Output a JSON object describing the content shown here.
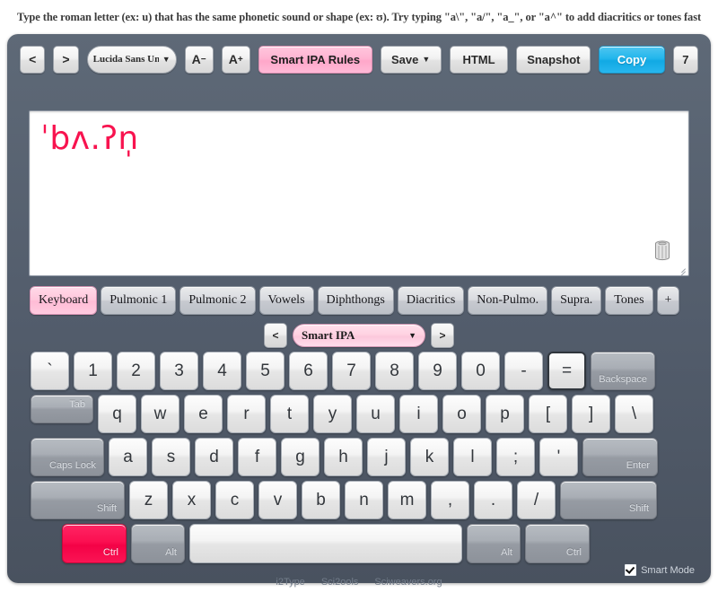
{
  "hint": "Type the roman letter (ex: u) that has the same phonetic sound or shape (ex: ʊ). Try typing \"a\\\", \"a/\", \"a_\", or \"a^\" to add diacritics or tones fast",
  "toolbar": {
    "prev_label": "<",
    "next_label": ">",
    "font_name": "Lucida Sans Unic",
    "font_caret": "▼",
    "font_decrease": "A",
    "font_decrease_sup": "−",
    "font_increase": "A",
    "font_increase_sup": "+",
    "rules_label": "Smart IPA Rules",
    "save_label": "Save",
    "save_caret": "▼",
    "html_label": "HTML",
    "snapshot_label": "Snapshot",
    "copy_label": "Copy",
    "char_count": "7",
    "accent_pink": "#ffb4d2",
    "accent_blue": "#11a9e4"
  },
  "editor": {
    "content": "ˈbʌ.ʔn̩",
    "text_color": "#f8134f"
  },
  "tabs": [
    {
      "label": "Keyboard",
      "active": true
    },
    {
      "label": "Pulmonic 1",
      "active": false
    },
    {
      "label": "Pulmonic 2",
      "active": false
    },
    {
      "label": "Vowels",
      "active": false
    },
    {
      "label": "Diphthongs",
      "active": false
    },
    {
      "label": "Diacritics",
      "active": false
    },
    {
      "label": "Non-Pulmo.",
      "active": false
    },
    {
      "label": "Supra.",
      "active": false
    },
    {
      "label": "Tones",
      "active": false
    },
    {
      "label": "+",
      "active": false
    }
  ],
  "layout_selector": {
    "prev_label": "<",
    "next_label": ">",
    "selected": "Smart IPA",
    "caret": "▼"
  },
  "keyboard": {
    "rows": [
      [
        {
          "label": "`",
          "type": "key"
        },
        {
          "label": "1",
          "type": "key"
        },
        {
          "label": "2",
          "type": "key"
        },
        {
          "label": "3",
          "type": "key"
        },
        {
          "label": "4",
          "type": "key"
        },
        {
          "label": "5",
          "type": "key"
        },
        {
          "label": "6",
          "type": "key"
        },
        {
          "label": "7",
          "type": "key"
        },
        {
          "label": "8",
          "type": "key"
        },
        {
          "label": "9",
          "type": "key"
        },
        {
          "label": "0",
          "type": "key"
        },
        {
          "label": "-",
          "type": "key"
        },
        {
          "label": "=",
          "type": "key",
          "state": "focused"
        },
        {
          "label": "Backspace",
          "type": "mod",
          "width": "backspace"
        }
      ],
      [
        {
          "label": "Tab",
          "type": "mod",
          "width": "tab"
        },
        {
          "label": "q",
          "type": "key"
        },
        {
          "label": "w",
          "type": "key"
        },
        {
          "label": "e",
          "type": "key"
        },
        {
          "label": "r",
          "type": "key"
        },
        {
          "label": "t",
          "type": "key"
        },
        {
          "label": "y",
          "type": "key"
        },
        {
          "label": "u",
          "type": "key"
        },
        {
          "label": "i",
          "type": "key"
        },
        {
          "label": "o",
          "type": "key"
        },
        {
          "label": "p",
          "type": "key"
        },
        {
          "label": "[",
          "type": "key"
        },
        {
          "label": "]",
          "type": "key"
        },
        {
          "label": "\\",
          "type": "key"
        }
      ],
      [
        {
          "label": "Caps Lock",
          "type": "mod",
          "width": "caps"
        },
        {
          "label": "a",
          "type": "key"
        },
        {
          "label": "s",
          "type": "key"
        },
        {
          "label": "d",
          "type": "key"
        },
        {
          "label": "f",
          "type": "key"
        },
        {
          "label": "g",
          "type": "key"
        },
        {
          "label": "h",
          "type": "key"
        },
        {
          "label": "j",
          "type": "key"
        },
        {
          "label": "k",
          "type": "key"
        },
        {
          "label": "l",
          "type": "key"
        },
        {
          "label": ";",
          "type": "key"
        },
        {
          "label": "'",
          "type": "key"
        },
        {
          "label": "Enter",
          "type": "mod",
          "width": "enter"
        }
      ],
      [
        {
          "label": "Shift",
          "type": "mod",
          "width": "shiftL"
        },
        {
          "label": "z",
          "type": "key"
        },
        {
          "label": "x",
          "type": "key"
        },
        {
          "label": "c",
          "type": "key"
        },
        {
          "label": "v",
          "type": "key"
        },
        {
          "label": "b",
          "type": "key"
        },
        {
          "label": "n",
          "type": "key"
        },
        {
          "label": "m",
          "type": "key"
        },
        {
          "label": ",",
          "type": "key"
        },
        {
          "label": ".",
          "type": "key"
        },
        {
          "label": "/",
          "type": "key"
        },
        {
          "label": "Shift",
          "type": "mod",
          "width": "shiftR"
        }
      ],
      [
        {
          "label": "Ctrl",
          "type": "mod",
          "width": "ctrl",
          "state": "active"
        },
        {
          "label": "Alt",
          "type": "mod",
          "width": "alt"
        },
        {
          "label": "",
          "type": "key",
          "width": "spacebar"
        },
        {
          "label": "Alt",
          "type": "mod",
          "width": "alt"
        },
        {
          "label": "Ctrl",
          "type": "mod",
          "width": "ctrl"
        }
      ]
    ]
  },
  "footer": {
    "links": [
      "i2Type",
      "Sci2ools",
      "Sciweavers.org"
    ],
    "smart_mode_label": "Smart Mode",
    "smart_mode_checked": true
  }
}
